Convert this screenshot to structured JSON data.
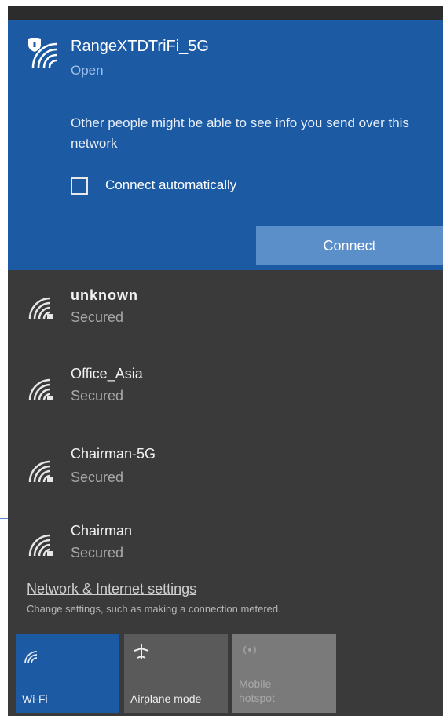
{
  "colors": {
    "selected_bg": "#1c5aa3",
    "panel_bg": "#3a3a3a",
    "connect_button": "#5b8fc9",
    "wifi_tile_active": "#1c5aa3",
    "tile_inactive": "#5a5a5a",
    "tile_disabled": "#7a7a7a"
  },
  "selected_network": {
    "icon": "wifi-open-shield-icon",
    "name": "RangeXTDTriFi_5G",
    "status": "Open",
    "warning": "Other people might be able to see info you send over this network",
    "connect_automatically_label": "Connect automatically",
    "connect_automatically_checked": false,
    "connect_button_label": "Connect"
  },
  "networks": [
    {
      "icon": "wifi-secured-icon",
      "name": "unknown",
      "status": "Secured"
    },
    {
      "icon": "wifi-secured-icon",
      "name": "Office_Asia",
      "status": "Secured"
    },
    {
      "icon": "wifi-secured-icon",
      "name": "Chairman-5G",
      "status": "Secured"
    },
    {
      "icon": "wifi-secured-icon",
      "name": "Chairman",
      "status": "Secured"
    }
  ],
  "settings": {
    "link_label": "Network & Internet settings",
    "description": "Change settings, such as making a connection metered."
  },
  "quick_actions": [
    {
      "icon": "wifi-icon",
      "label": "Wi-Fi",
      "state": "on"
    },
    {
      "icon": "airplane-icon",
      "label": "Airplane mode",
      "state": "off"
    },
    {
      "icon": "mobile-hotspot-icon",
      "label_line1": "Mobile",
      "label_line2": "hotspot",
      "state": "disabled"
    }
  ]
}
